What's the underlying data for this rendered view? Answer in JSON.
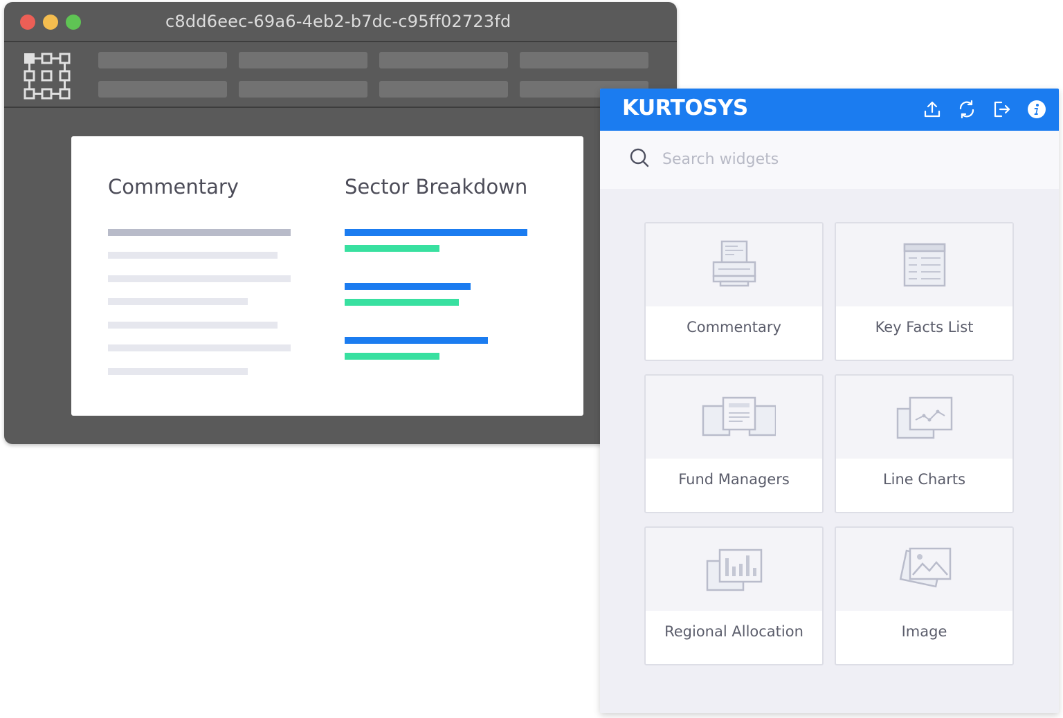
{
  "window": {
    "title": "c8dd6eec-69a6-4eb2-b7dc-c95ff02723fd"
  },
  "card": {
    "left_heading": "Commentary",
    "right_heading": "Sector Breakdown"
  },
  "panel": {
    "brand": "KURTOSYS",
    "header_icons": [
      "upload-icon",
      "refresh-icon",
      "logout-icon",
      "info-icon"
    ],
    "search": {
      "placeholder": "Search widgets",
      "value": ""
    },
    "widgets": [
      {
        "label": "Commentary",
        "icon": "commentary-icon"
      },
      {
        "label": "Key Facts List",
        "icon": "key-facts-list-icon"
      },
      {
        "label": "Fund Managers",
        "icon": "fund-managers-icon"
      },
      {
        "label": "Line Charts",
        "icon": "line-charts-icon"
      },
      {
        "label": "Regional Allocation",
        "icon": "regional-allocation-icon"
      },
      {
        "label": "Image",
        "icon": "image-icon"
      }
    ]
  },
  "colors": {
    "brand_blue": "#1b7cf0",
    "accent_green": "#38e0a0",
    "window_gray": "#5a5a5a"
  }
}
